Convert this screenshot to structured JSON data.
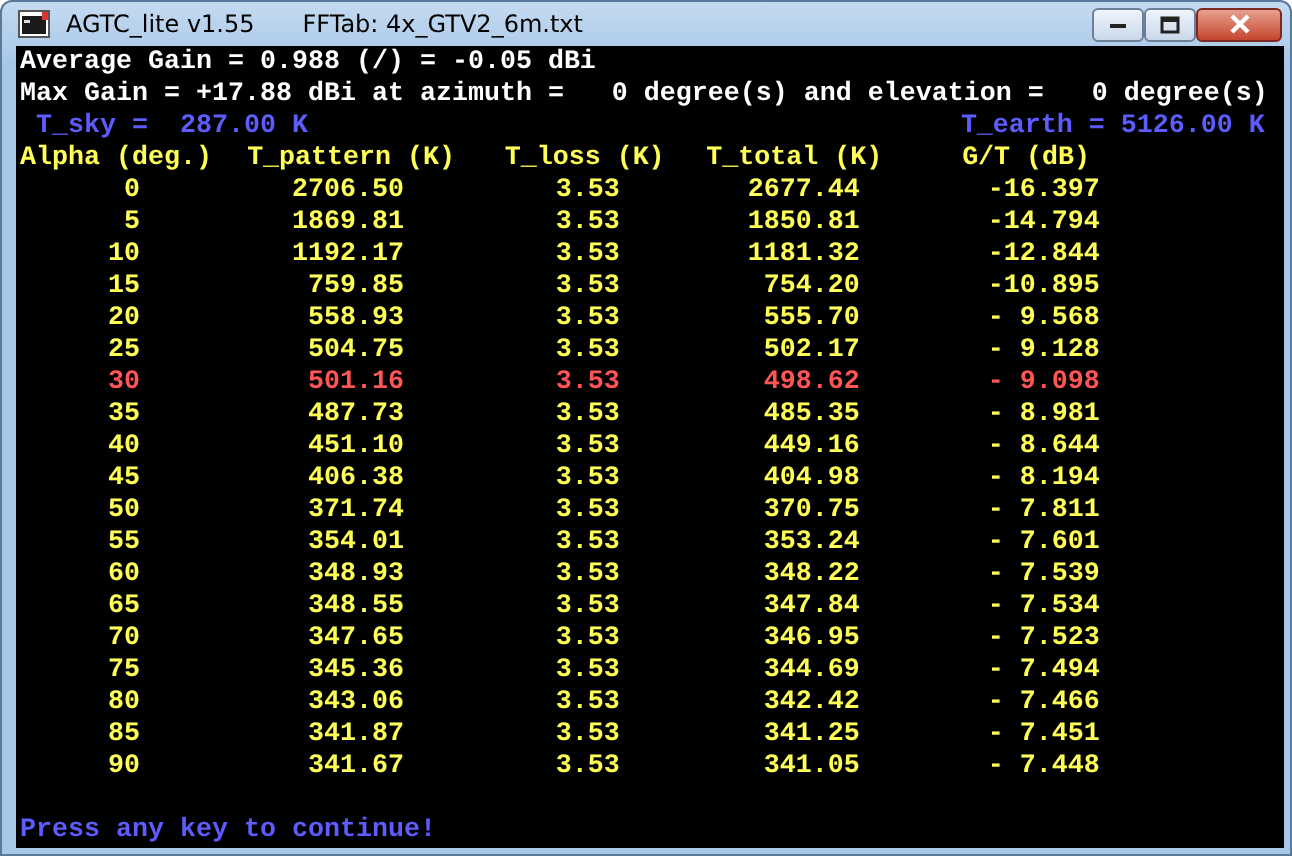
{
  "window": {
    "title": "AGTC_lite v1.55",
    "subtitle": "FFTab: 4x_GTV2_6m.txt"
  },
  "info_lines": [
    "Average Gain = 0.988 (/) = -0.05 dBi",
    "Max Gain = +17.88 dBi at azimuth =   0 degree(s) and elevation =   0 degree(s)"
  ],
  "t_sky": "T_sky =  287.00 K",
  "t_earth": "T_earth = 5126.00 K",
  "table": {
    "columns": [
      "Alpha (deg.)",
      "T_pattern (K)",
      "T_loss (K)",
      "T_total (K)",
      "G/T (dB)"
    ],
    "rows": [
      {
        "cells": [
          "0",
          "2706.50",
          "3.53",
          "2677.44",
          "-16.397"
        ],
        "highlighted": false
      },
      {
        "cells": [
          "5",
          "1869.81",
          "3.53",
          "1850.81",
          "-14.794"
        ],
        "highlighted": false
      },
      {
        "cells": [
          "10",
          "1192.17",
          "3.53",
          "1181.32",
          "-12.844"
        ],
        "highlighted": false
      },
      {
        "cells": [
          "15",
          "759.85",
          "3.53",
          "754.20",
          "-10.895"
        ],
        "highlighted": false
      },
      {
        "cells": [
          "20",
          "558.93",
          "3.53",
          "555.70",
          "- 9.568"
        ],
        "highlighted": false
      },
      {
        "cells": [
          "25",
          "504.75",
          "3.53",
          "502.17",
          "- 9.128"
        ],
        "highlighted": false
      },
      {
        "cells": [
          "30",
          "501.16",
          "3.53",
          "498.62",
          "- 9.098"
        ],
        "highlighted": true
      },
      {
        "cells": [
          "35",
          "487.73",
          "3.53",
          "485.35",
          "- 8.981"
        ],
        "highlighted": false
      },
      {
        "cells": [
          "40",
          "451.10",
          "3.53",
          "449.16",
          "- 8.644"
        ],
        "highlighted": false
      },
      {
        "cells": [
          "45",
          "406.38",
          "3.53",
          "404.98",
          "- 8.194"
        ],
        "highlighted": false
      },
      {
        "cells": [
          "50",
          "371.74",
          "3.53",
          "370.75",
          "- 7.811"
        ],
        "highlighted": false
      },
      {
        "cells": [
          "55",
          "354.01",
          "3.53",
          "353.24",
          "- 7.601"
        ],
        "highlighted": false
      },
      {
        "cells": [
          "60",
          "348.93",
          "3.53",
          "348.22",
          "- 7.539"
        ],
        "highlighted": false
      },
      {
        "cells": [
          "65",
          "348.55",
          "3.53",
          "347.84",
          "- 7.534"
        ],
        "highlighted": false
      },
      {
        "cells": [
          "70",
          "347.65",
          "3.53",
          "346.95",
          "- 7.523"
        ],
        "highlighted": false
      },
      {
        "cells": [
          "75",
          "345.36",
          "3.53",
          "344.69",
          "- 7.494"
        ],
        "highlighted": false
      },
      {
        "cells": [
          "80",
          "343.06",
          "3.53",
          "342.42",
          "- 7.466"
        ],
        "highlighted": false
      },
      {
        "cells": [
          "85",
          "341.87",
          "3.53",
          "341.25",
          "- 7.451"
        ],
        "highlighted": false
      },
      {
        "cells": [
          "90",
          "341.67",
          "3.53",
          "341.05",
          "- 7.448"
        ],
        "highlighted": false
      }
    ]
  },
  "prompt": "Press any key to continue!"
}
